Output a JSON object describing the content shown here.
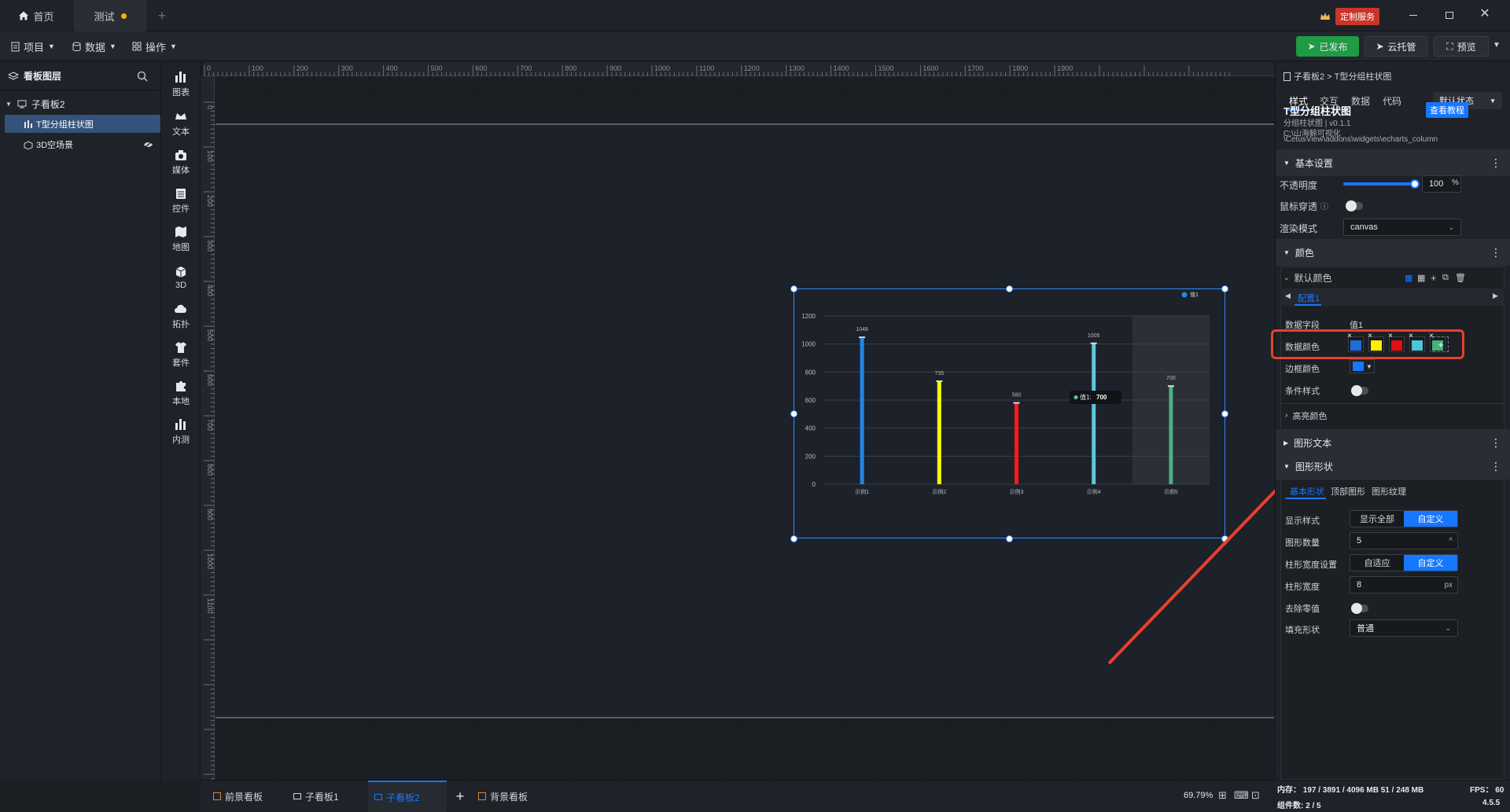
{
  "titlebar": {
    "tabs": [
      {
        "label": "首页"
      },
      {
        "label": "测试"
      }
    ],
    "custom_service": "定制服务"
  },
  "toolbar": {
    "menus": [
      "项目",
      "数据",
      "操作"
    ],
    "published": "已发布",
    "cloud": "云托管",
    "preview": "预览"
  },
  "layers": {
    "title": "看板图层",
    "items": [
      {
        "label": "子看板2"
      },
      {
        "label": "T型分组柱状图"
      },
      {
        "label": "3D空场景"
      }
    ]
  },
  "rail": [
    "图表",
    "文本",
    "媒体",
    "控件",
    "地图",
    "3D",
    "拓扑",
    "套件",
    "本地",
    "内测"
  ],
  "ruler": {
    "top": [
      "0",
      "100",
      "200",
      "300",
      "400",
      "500",
      "600",
      "700",
      "800",
      "900",
      "1000",
      "1100",
      "1200",
      "1300",
      "1400",
      "1500",
      "1600",
      "1700",
      "1800",
      "1900"
    ],
    "left": [
      "0",
      "100",
      "200",
      "300",
      "400",
      "500",
      "600",
      "700",
      "800",
      "900",
      "1000",
      "1100"
    ]
  },
  "chart_data": {
    "type": "bar",
    "categories": [
      "示例1",
      "示例2",
      "示例3",
      "示例4",
      "示例5"
    ],
    "series": [
      {
        "name": "值1",
        "values": [
          1048,
          735,
          580,
          1005,
          700
        ]
      }
    ],
    "bar_colors": [
      "#1e88e5",
      "#ffff00",
      "#ff1a1a",
      "#5bc8d6",
      "#4caf7d"
    ],
    "ylim": [
      0,
      1200
    ],
    "yticks": [
      "0",
      "200",
      "400",
      "600",
      "800",
      "1000",
      "1200"
    ],
    "data_labels": [
      "1048",
      "735",
      "580",
      "1005",
      "700"
    ],
    "legend": "top-right",
    "grid": true,
    "tooltip": {
      "label": "值1:",
      "value": "700"
    }
  },
  "right": {
    "breadcrumb": "子看板2 > T型分组柱状图",
    "tabs": [
      "样式",
      "交互",
      "数据",
      "代码"
    ],
    "state": "默认状态",
    "widget_title": "T型分组柱状图",
    "widget_sub": "分组柱状图 | v0.1.1",
    "widget_path1": "C:\\山海鲸可视化",
    "widget_path2": "\\CetusView\\addons\\widgets\\echarts_column",
    "tutorial": "查看教程",
    "basic": "基本设置",
    "opacity_label": "不透明度",
    "opacity_value": "100",
    "opacity_unit": "%",
    "mouse_label": "鼠标穿透",
    "render_label": "渲染模式",
    "render_value": "canvas",
    "color_sec": "颜色",
    "default_color": "默认颜色",
    "config_tab": "配置1",
    "field_label": "数据字段",
    "field_value": "值1",
    "data_color_label": "数据颜色",
    "border_color_label": "边框颜色",
    "cond_label": "条件样式",
    "highlight": "高亮颜色",
    "graphic_text": "图形文本",
    "graphic_shape": "图形形状",
    "shape_tabs": [
      "基本形状",
      "顶部图形",
      "图形纹理"
    ],
    "display_label": "显示样式",
    "display_opts": [
      "显示全部",
      "自定义"
    ],
    "count_label": "图形数量",
    "count_value": "5",
    "width_set_label": "柱形宽度设置",
    "width_set_opts": [
      "自适应",
      "自定义"
    ],
    "width_label": "柱形宽度",
    "width_value": "8",
    "width_unit": "px",
    "remove_zero": "去除零值",
    "fill_label": "填充形状",
    "fill_value": "普通"
  },
  "colors": {
    "swatches": [
      "#1e6fd9",
      "#ffee00",
      "#e01010",
      "#4fc3d8",
      "#45b07a"
    ],
    "accent": "#1677ff",
    "highlight_box": "#e8412c"
  },
  "bottom": {
    "tabs": [
      "前景看板",
      "子看板1",
      "子看板2",
      "背景看板"
    ],
    "zoom": "69.79%"
  },
  "status": {
    "memory": "内存： 197 / 3891 / 4096 MB  51 / 248 MB",
    "fps": "FPS： 60",
    "components": "组件数: 2 / 5",
    "version": "4.5.5"
  }
}
